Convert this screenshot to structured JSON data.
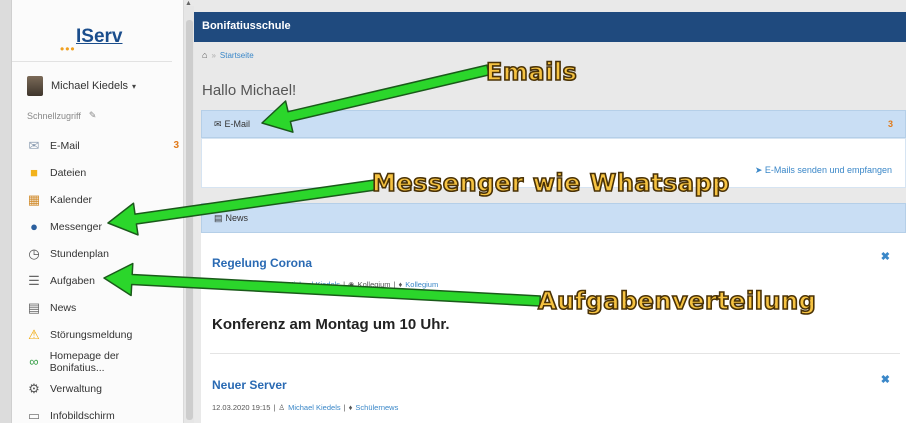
{
  "logo": {
    "text": "IServ",
    "dots": "•••"
  },
  "user": {
    "name": "Michael Kiedels",
    "caret": "▾"
  },
  "quick_access": {
    "label": "Schnellzugriff",
    "edit_icon": "✎"
  },
  "sidebar": {
    "items": [
      {
        "label": "E-Mail",
        "icon": "✉",
        "icon_name": "envelope-icon",
        "badge": "3",
        "icon_color": "#8a9bb0"
      },
      {
        "label": "Dateien",
        "icon": "■",
        "icon_name": "folder-icon",
        "icon_color": "#f2b21b"
      },
      {
        "label": "Kalender",
        "icon": "▦",
        "icon_name": "calendar-icon",
        "icon_color": "#d08a2a"
      },
      {
        "label": "Messenger",
        "icon": "●",
        "icon_name": "chat-bubbles-icon",
        "icon_color": "#2b5f9e"
      },
      {
        "label": "Stundenplan",
        "icon": "◷",
        "icon_name": "clock-icon",
        "icon_color": "#555555"
      },
      {
        "label": "Aufgaben",
        "icon": "☰",
        "icon_name": "clipboard-icon",
        "icon_color": "#666666"
      },
      {
        "label": "News",
        "icon": "▤",
        "icon_name": "newspaper-icon",
        "icon_color": "#666666"
      },
      {
        "label": "Störungsmeldung",
        "icon": "⚠",
        "icon_name": "warning-icon",
        "icon_color": "#f0a500"
      },
      {
        "label": "Homepage der Bonifatius...",
        "icon": "∞",
        "icon_name": "link-icon",
        "icon_color": "#3aa04a"
      },
      {
        "label": "Verwaltung",
        "icon": "⚙",
        "icon_name": "gear-icon",
        "icon_color": "#555555"
      },
      {
        "label": "Infobildschirm",
        "icon": "▭",
        "icon_name": "monitor-icon",
        "icon_color": "#777777"
      }
    ]
  },
  "header": {
    "title": "Bonifatiusschule"
  },
  "breadcrumb": {
    "home_icon": "⌂",
    "separator": "»",
    "current": "Startseite"
  },
  "greeting": "Hallo Michael!",
  "email_panel": {
    "icon": "✉",
    "title": "E-Mail",
    "count": "3",
    "action": "➤ E-Mails senden und empfangen"
  },
  "news_panel": {
    "icon": "▤",
    "title": "News"
  },
  "news": [
    {
      "title": "Regelung Corona",
      "date": "12.03.2020 19:11",
      "author": "Michael Kiedels",
      "group": "Kollegium",
      "tag": "Kollegium",
      "body": "Konferenz am Montag um 10 Uhr.",
      "close": "✖"
    },
    {
      "title": "Neuer Server",
      "date": "12.03.2020 19:15",
      "author": "Michael Kiedels",
      "tag": "Schülernews",
      "close": "✖"
    }
  ],
  "annotations": {
    "emails": "Emails",
    "messenger": "Messenger wie Whatsapp",
    "tasks": "Aufgabenverteilung",
    "arrow_color": "#2bd62b"
  }
}
